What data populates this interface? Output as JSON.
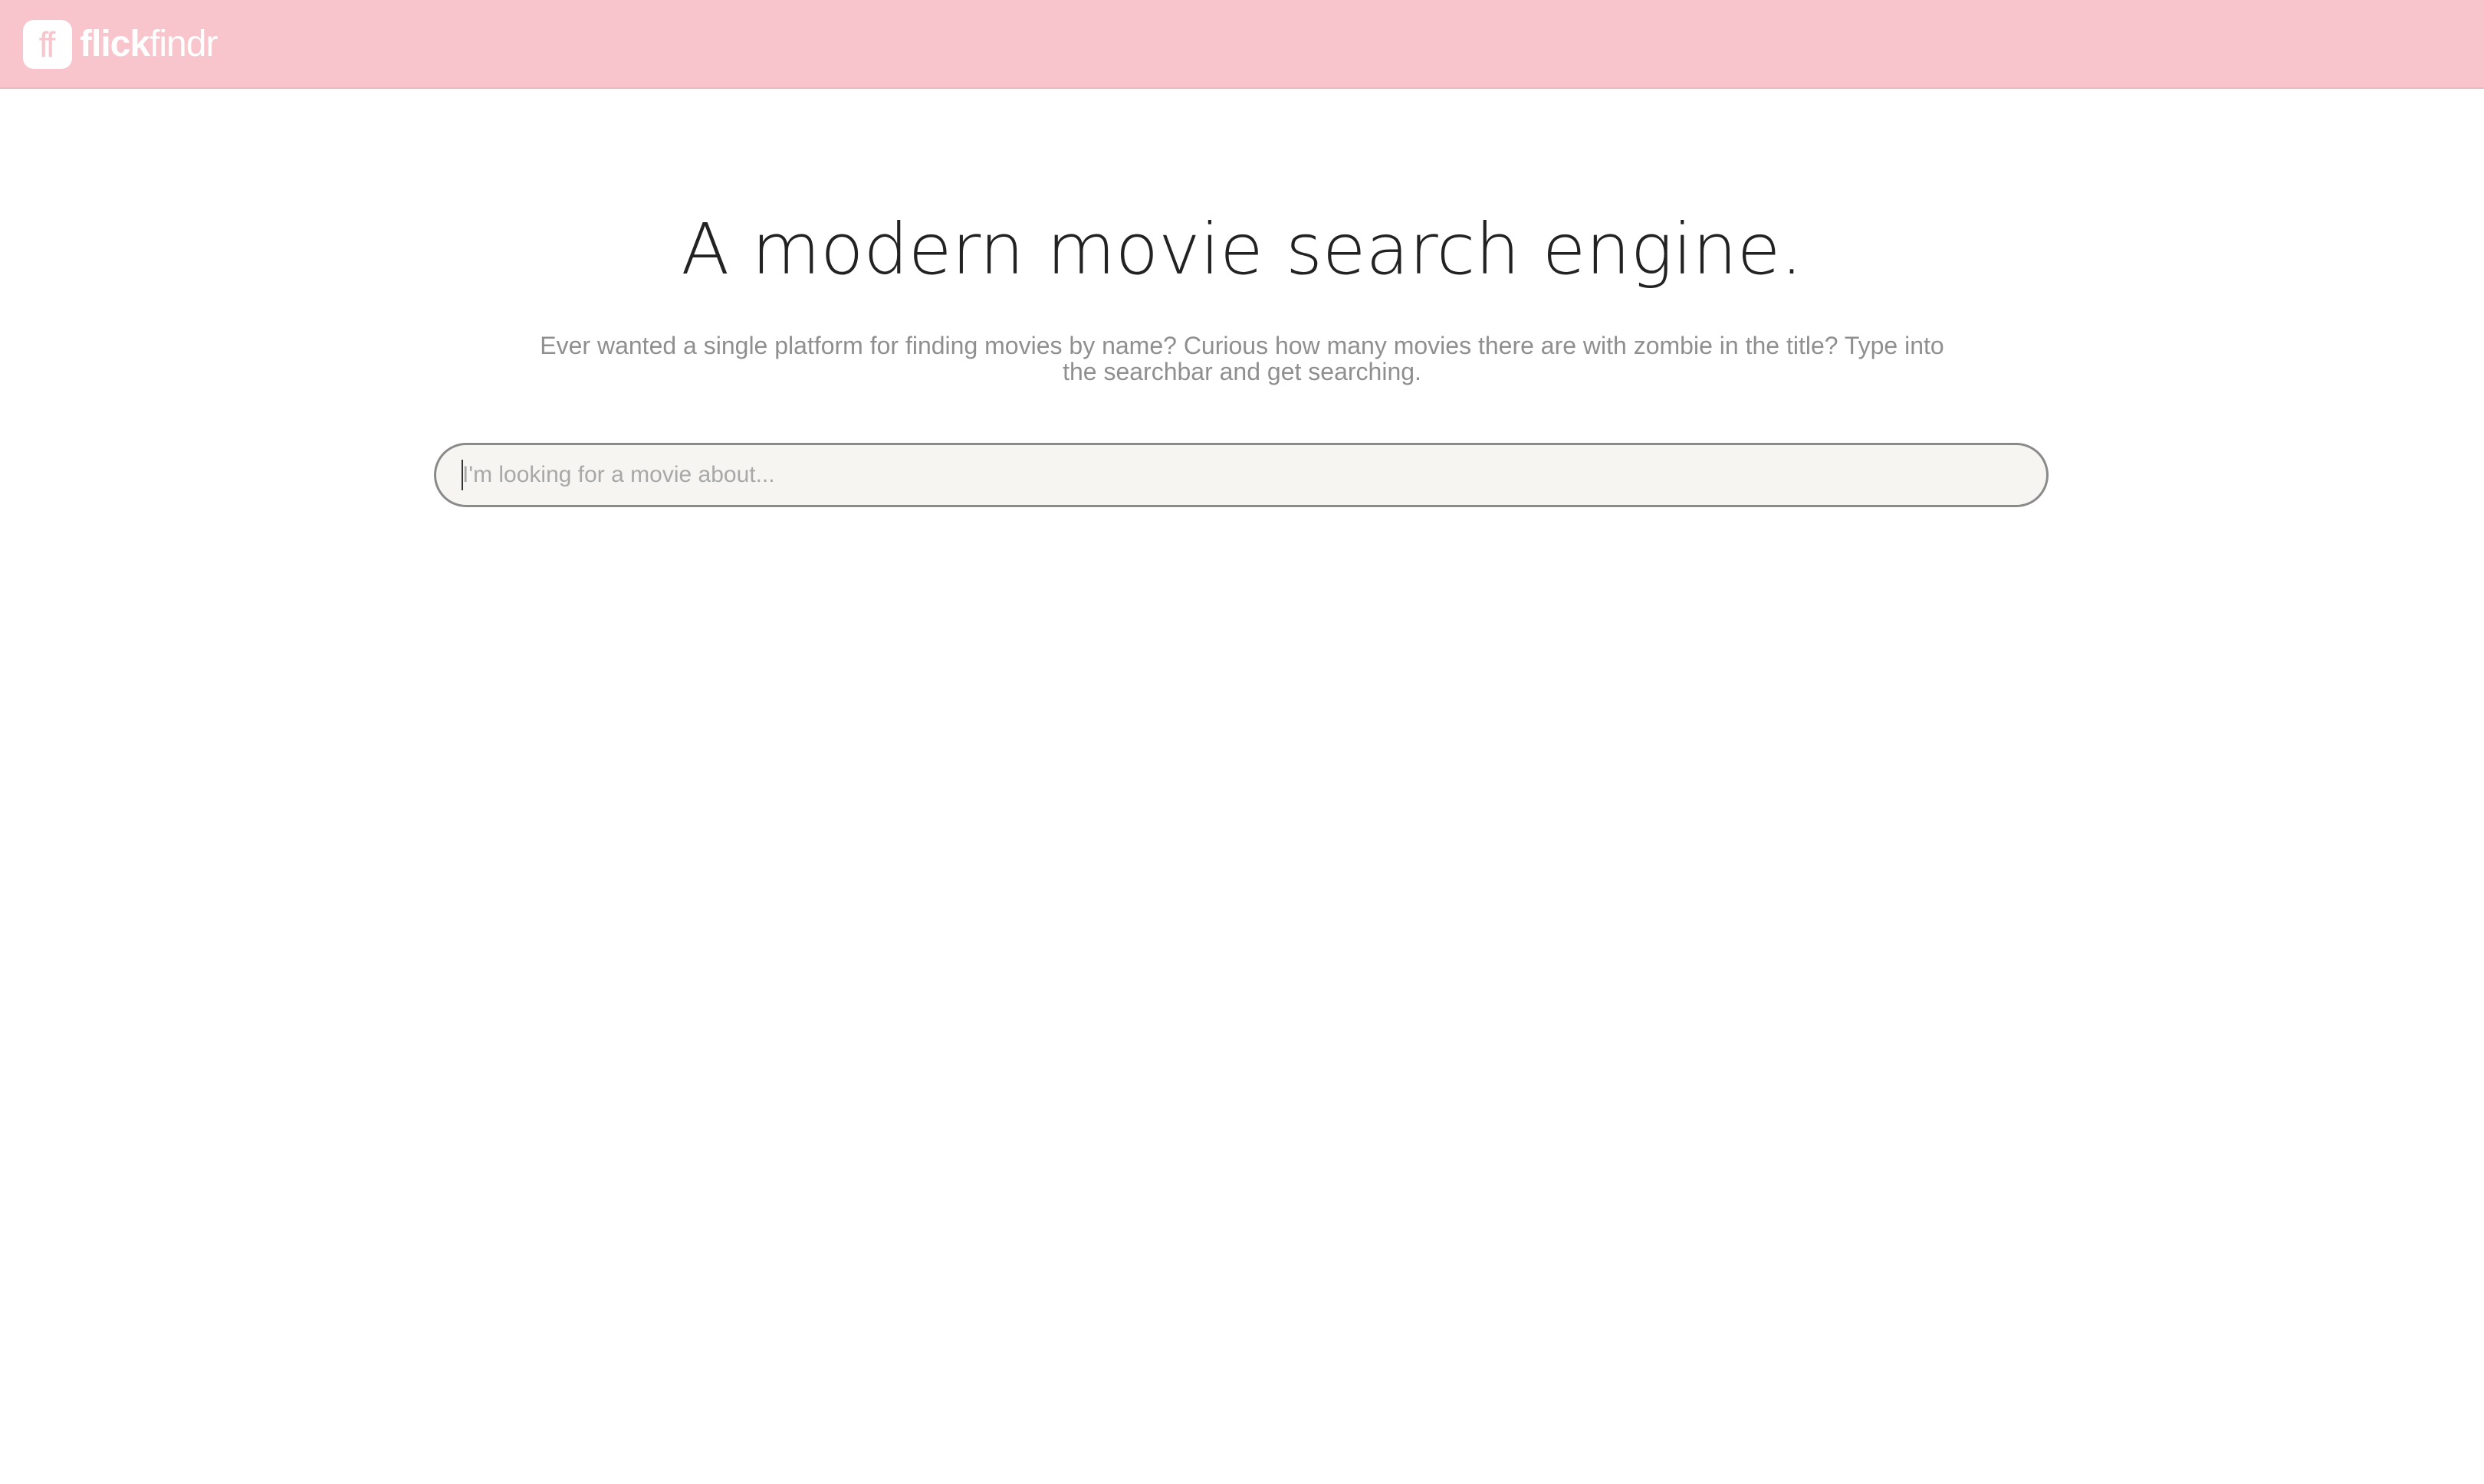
{
  "header": {
    "logo_mark": "ff",
    "brand_bold": "flick",
    "brand_light": "findr",
    "background_color": "#f7c5cb"
  },
  "hero": {
    "headline": "A modern movie search engine.",
    "description": "Ever wanted a single platform for finding movies by name? Curious how many movies there are with zombie in the title? Type into the searchbar and get searching."
  },
  "search": {
    "value": "",
    "placeholder": "I'm looking for a movie about..."
  }
}
